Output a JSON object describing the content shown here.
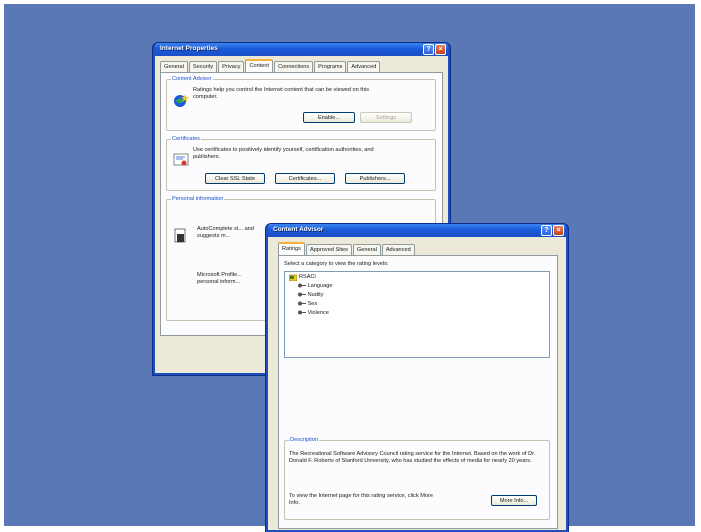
{
  "internet_properties": {
    "title": "Internet Properties",
    "tabs": [
      "General",
      "Security",
      "Privacy",
      "Content",
      "Connections",
      "Programs",
      "Advanced"
    ],
    "active_tab": "Content",
    "content_advisor": {
      "label": "Content Advisor",
      "description": "Ratings help you control the Internet content that can be viewed on this computer.",
      "enable_button": "Enable...",
      "settings_button": "Settings"
    },
    "certificates": {
      "label": "Certificates",
      "description": "Use certificates to positively identify yourself, certification authorities, and publishers.",
      "clear_ssl_button": "Clear SSL State",
      "certificates_button": "Certificates...",
      "publishers_button": "Publishers..."
    },
    "personal_information": {
      "label": "Personal information",
      "autocomplete_text": "AutoComplete st... and suggests m...",
      "profile_text": "Microsoft Profile... personal inform..."
    }
  },
  "content_advisor_dialog": {
    "title": "Content Advisor",
    "tabs": [
      "Ratings",
      "Approved Sites",
      "General",
      "Advanced"
    ],
    "active_tab": "Ratings",
    "prompt": "Select a category to view the rating levels:",
    "tree": {
      "root": "RSACi",
      "children": [
        "Language",
        "Nudity",
        "Sex",
        "Violence"
      ]
    },
    "description": {
      "label": "Description",
      "text": "The Recreational Software Advisory Council rating service for the Internet.  Based on the work of Dr. Donald F. Roberts of Stanford University, who has studied the effects of media for nearly 20 years.",
      "more_info_prompt": "To view the Internet page for this rating service, click More Info.",
      "more_info_button": "More Info..."
    }
  },
  "titlebar_buttons": {
    "help": "?",
    "close": "×"
  },
  "colors": {
    "desktop": "#5b78b6",
    "titlebar": "#1b5ad8",
    "dialog_face": "#ece9d8",
    "group_label": "#1c4fcf"
  }
}
